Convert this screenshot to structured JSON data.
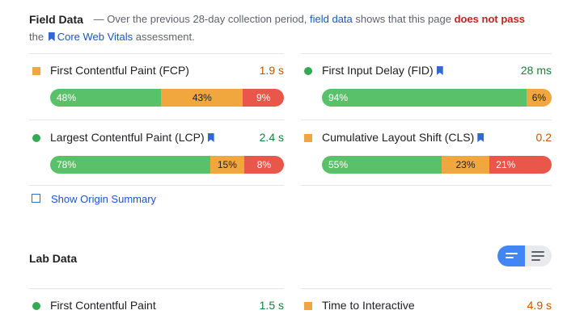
{
  "field": {
    "title": "Field Data",
    "desc_dash": "—",
    "desc_part1": "Over the previous 28-day collection period,",
    "desc_link": "field data",
    "desc_part2": "shows that this page",
    "desc_fail": "does not pass",
    "desc_the": "the",
    "desc_cwv": "Core Web Vitals",
    "desc_assess": "assessment.",
    "metrics": {
      "fcp": {
        "name": "First Contentful Paint (FCP)",
        "value": "1.9 s",
        "good": "48%",
        "ni": "43%",
        "poor": "9%"
      },
      "fid": {
        "name": "First Input Delay (FID)",
        "value": "28 ms",
        "good": "94%",
        "ni": "6%"
      },
      "lcp": {
        "name": "Largest Contentful Paint (LCP)",
        "value": "2.4 s",
        "good": "78%",
        "ni": "15%",
        "poor": "8%"
      },
      "cls": {
        "name": "Cumulative Layout Shift (CLS)",
        "value": "0.2",
        "good": "55%",
        "ni": "23%",
        "poor": "21%"
      }
    },
    "origin_summary": "Show Origin Summary"
  },
  "lab": {
    "title": "Lab Data",
    "fcp_name": "First Contentful Paint",
    "fcp_value": "1.5 s",
    "tti_name": "Time to Interactive",
    "tti_value": "4.9 s"
  },
  "colors": {
    "good": "#5ac16b",
    "needs_improvement": "#f2a73e",
    "poor": "#e8574a",
    "accent": "#4285f4"
  }
}
